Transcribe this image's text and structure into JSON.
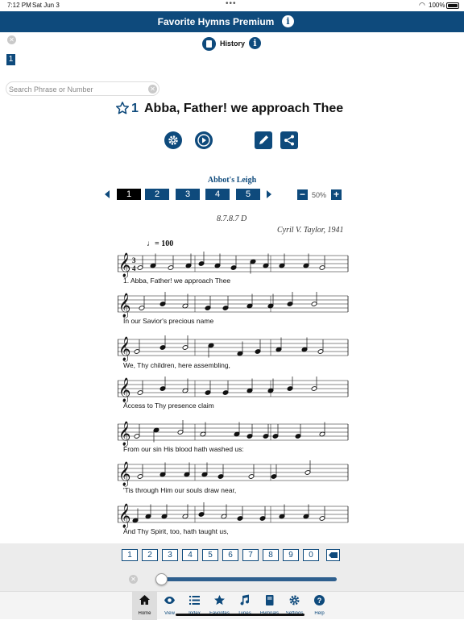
{
  "status": {
    "time": "7:12 PM",
    "date": "Sat Jun 3",
    "battery": "100%"
  },
  "app": {
    "title": "Favorite Hymns Premium"
  },
  "history": {
    "label": "History",
    "badge": "1"
  },
  "search": {
    "placeholder": "Search Phrase or Number",
    "value": ""
  },
  "hymn": {
    "number": "1",
    "title": "Abba, Father! we approach Thee",
    "favorited": false,
    "tune": "Abbot's Leigh",
    "meter": "8.7.8.7 D",
    "author": "Cyril V. Taylor, 1941",
    "tempo": "= 100"
  },
  "verses": {
    "items": [
      "1",
      "2",
      "3",
      "4",
      "5"
    ],
    "selected": "1"
  },
  "zoom": {
    "label": "50%",
    "minus": "−",
    "plus": "+"
  },
  "lyrics": [
    "1. Abba, Father! we approach Thee",
    "In our Savior's precious name",
    "We, Thy children, here assembling,",
    "Access to Thy presence claim",
    "From our sin His blood hath washed us:",
    "'Tis through Him our souls draw near,",
    "And Thy Spirit, too, hath taught us,"
  ],
  "keypad": [
    "1",
    "2",
    "3",
    "4",
    "5",
    "6",
    "7",
    "8",
    "9",
    "0"
  ],
  "player": {
    "position": 0
  },
  "tabs": [
    {
      "label": "Home",
      "icon": "home-icon"
    },
    {
      "label": "View",
      "icon": "eye-icon"
    },
    {
      "label": "Index",
      "icon": "list-icon"
    },
    {
      "label": "Favorites",
      "icon": "star-icon"
    },
    {
      "label": "Tunes",
      "icon": "music-note-icon"
    },
    {
      "label": "Hymnals",
      "icon": "book-icon"
    },
    {
      "label": "Settings",
      "icon": "gear-icon"
    },
    {
      "label": "Help",
      "icon": "help-icon"
    }
  ],
  "colors": {
    "brand": "#0e4a7c",
    "active_verse": "#000000"
  }
}
